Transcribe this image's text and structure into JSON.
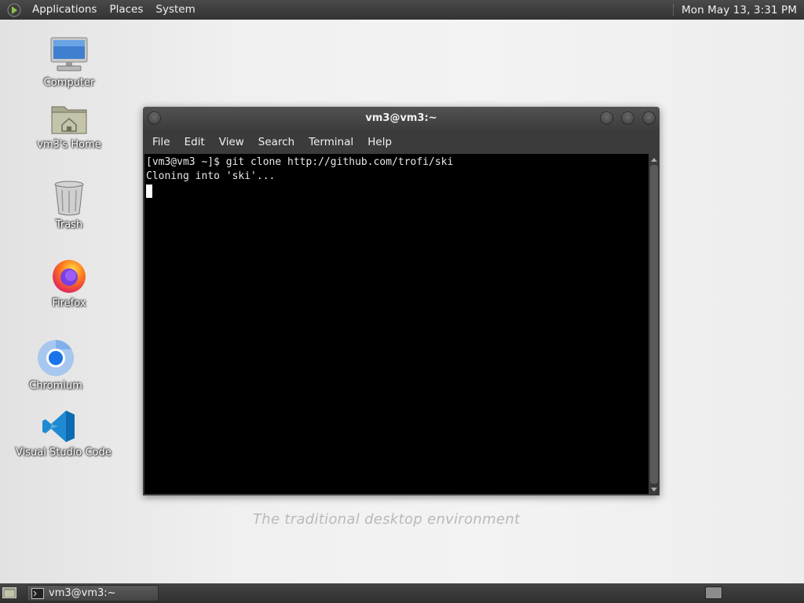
{
  "top_panel": {
    "menus": [
      "Applications",
      "Places",
      "System"
    ],
    "clock": "Mon May 13,  3:31 PM"
  },
  "desktop": {
    "icons": [
      {
        "label": "Computer",
        "icon": "computer-icon"
      },
      {
        "label": "vm3's Home",
        "icon": "home-folder-icon"
      },
      {
        "label": "Trash",
        "icon": "trash-icon"
      },
      {
        "label": "Firefox",
        "icon": "firefox-icon"
      },
      {
        "label": "Chromium",
        "icon": "chromium-icon"
      },
      {
        "label": "Visual Studio Code",
        "icon": "vscode-icon"
      }
    ],
    "wallpaper_text": "The traditional desktop environment"
  },
  "terminal_window": {
    "title": "vm3@vm3:~",
    "menus": [
      "File",
      "Edit",
      "View",
      "Search",
      "Terminal",
      "Help"
    ],
    "lines": [
      "[vm3@vm3 ~]$ git clone http://github.com/trofi/ski",
      "Cloning into 'ski'..."
    ]
  },
  "bottom_panel": {
    "taskbar_item": "vm3@vm3:~"
  }
}
